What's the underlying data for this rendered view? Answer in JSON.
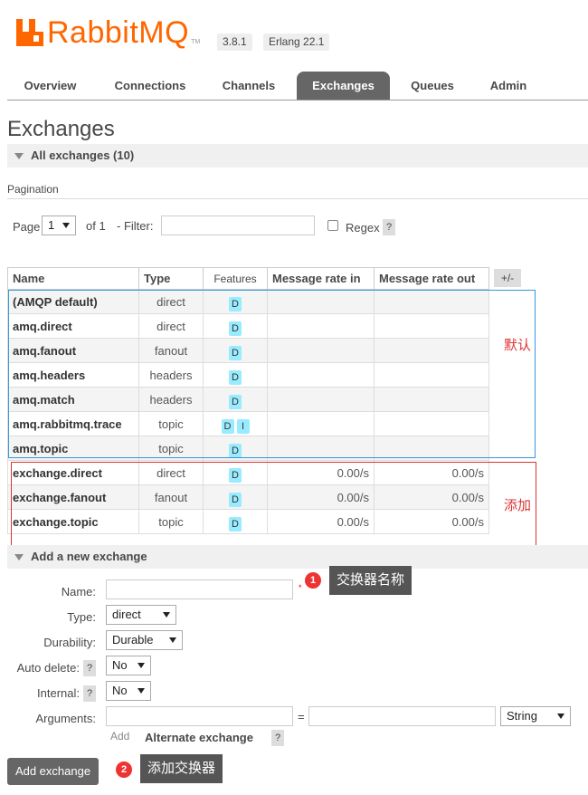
{
  "header": {
    "logo_text": "RabbitMQ",
    "logo_tm": "TM",
    "version": "3.8.1",
    "erlang": "Erlang 22.1",
    "brand_color": "#ff6600"
  },
  "tabs": [
    {
      "label": "Overview"
    },
    {
      "label": "Connections"
    },
    {
      "label": "Channels"
    },
    {
      "label": "Exchanges",
      "active": true
    },
    {
      "label": "Queues"
    },
    {
      "label": "Admin"
    }
  ],
  "page_title": "Exchanges",
  "all_exchanges": {
    "label": "All exchanges (10)"
  },
  "pagination": {
    "heading": "Pagination",
    "page_label": "Page",
    "page_value": "1",
    "of_label": "of 1",
    "filter_label": "- Filter:",
    "filter_value": "",
    "regex_label": "Regex",
    "help": "?"
  },
  "table": {
    "headers": {
      "name": "Name",
      "type": "Type",
      "features": "Features",
      "rate_in": "Message rate in",
      "rate_out": "Message rate out"
    },
    "plus_minus": "+/-",
    "rows": [
      {
        "name": "(AMQP default)",
        "type": "direct",
        "features": [
          "D"
        ],
        "rate_in": "",
        "rate_out": ""
      },
      {
        "name": "amq.direct",
        "type": "direct",
        "features": [
          "D"
        ],
        "rate_in": "",
        "rate_out": ""
      },
      {
        "name": "amq.fanout",
        "type": "fanout",
        "features": [
          "D"
        ],
        "rate_in": "",
        "rate_out": ""
      },
      {
        "name": "amq.headers",
        "type": "headers",
        "features": [
          "D"
        ],
        "rate_in": "",
        "rate_out": ""
      },
      {
        "name": "amq.match",
        "type": "headers",
        "features": [
          "D"
        ],
        "rate_in": "",
        "rate_out": ""
      },
      {
        "name": "amq.rabbitmq.trace",
        "type": "topic",
        "features": [
          "D",
          "I"
        ],
        "rate_in": "",
        "rate_out": ""
      },
      {
        "name": "amq.topic",
        "type": "topic",
        "features": [
          "D"
        ],
        "rate_in": "",
        "rate_out": ""
      },
      {
        "name": "exchange.direct",
        "type": "direct",
        "features": [
          "D"
        ],
        "rate_in": "0.00/s",
        "rate_out": "0.00/s"
      },
      {
        "name": "exchange.fanout",
        "type": "fanout",
        "features": [
          "D"
        ],
        "rate_in": "0.00/s",
        "rate_out": "0.00/s"
      },
      {
        "name": "exchange.topic",
        "type": "topic",
        "features": [
          "D"
        ],
        "rate_in": "0.00/s",
        "rate_out": "0.00/s"
      }
    ]
  },
  "annotations": {
    "default_label": "默认",
    "default_color": "#3399dd",
    "added_label": "添加",
    "added_color": "#dd3333",
    "name_callout": "交换器名称",
    "name_badge": "1",
    "add_callout": "添加交换器",
    "add_badge": "2"
  },
  "add_exchange": {
    "heading": "Add a new exchange",
    "name_label": "Name:",
    "name_value": "",
    "required_mark": "*",
    "type_label": "Type:",
    "type_value": "direct",
    "durability_label": "Durability:",
    "durability_value": "Durable",
    "auto_delete_label": "Auto delete:",
    "auto_delete_value": "No",
    "internal_label": "Internal:",
    "internal_value": "No",
    "arguments_label": "Arguments:",
    "arg_key": "",
    "arg_eq": "=",
    "arg_value": "",
    "arg_type": "String",
    "add_label": "Add",
    "alternate_label": "Alternate exchange",
    "help": "?",
    "submit_label": "Add exchange"
  }
}
